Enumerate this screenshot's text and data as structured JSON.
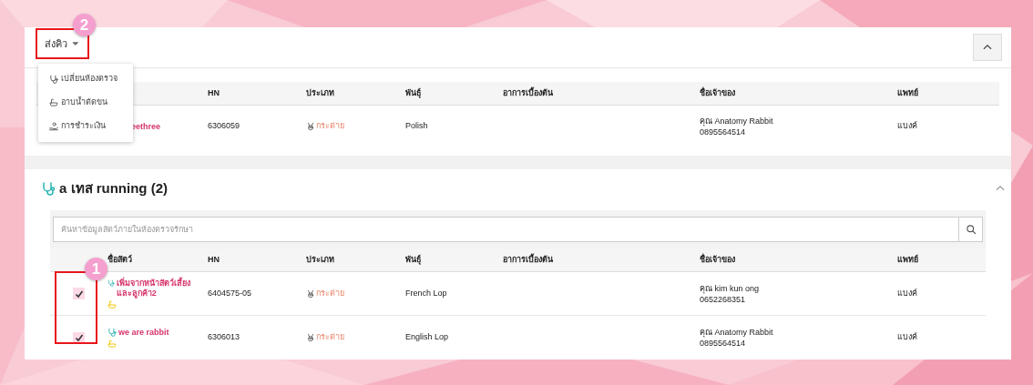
{
  "queue_button": {
    "label": "ส่งคิว"
  },
  "queue_menu": {
    "items": [
      {
        "label": "เปลี่ยนห้องตรวจ"
      },
      {
        "label": "อาบน้ำตัดขน"
      },
      {
        "label": "การชำระเงิน"
      }
    ]
  },
  "rooms": [
    {
      "columns": [
        "HN",
        "ประเภท",
        "พันธุ์",
        "อาการเบื้องต้น",
        "ชื่อเจ้าของ",
        "แพทย์"
      ],
      "rows": [
        {
          "kind": "plain",
          "name": "eethree",
          "hn": "6306059",
          "type": "กระต่าย",
          "breed": "Polish",
          "owner": "คุณ Anatomy Rabbit",
          "phone": "0895564514",
          "doctor": "แบงค์"
        }
      ]
    },
    {
      "title": "a เทส running (2)",
      "search": {
        "placeholder": "ค้นหาข้อมูลสัตว์ภายในห้องตรวจรักษา"
      },
      "columns": [
        "ชื่อสัตว์",
        "HN",
        "ประเภท",
        "พันธุ์",
        "อาการเบื้องต้น",
        "ชื่อเจ้าของ",
        "แพทย์"
      ],
      "rows": [
        {
          "kind": "marked",
          "checked": true,
          "name": "เพิ่มจากหน้าสัตว์เลี้ยงและลูกค้า2",
          "hn": "6404575-05",
          "type": "กระต่าย",
          "breed": "French Lop",
          "owner": "คุณ kim kun ong",
          "phone": "0652268351",
          "doctor": "แบงค์"
        },
        {
          "kind": "marked",
          "checked": true,
          "name": "we are rabbit",
          "hn": "6306013",
          "type": "กระต่าย",
          "breed": "English Lop",
          "owner": "คุณ Anatomy Rabbit",
          "phone": "0895564514",
          "doctor": "แบงค์"
        }
      ]
    }
  ],
  "callouts": [
    {
      "number": "2"
    },
    {
      "number": "1"
    }
  ]
}
